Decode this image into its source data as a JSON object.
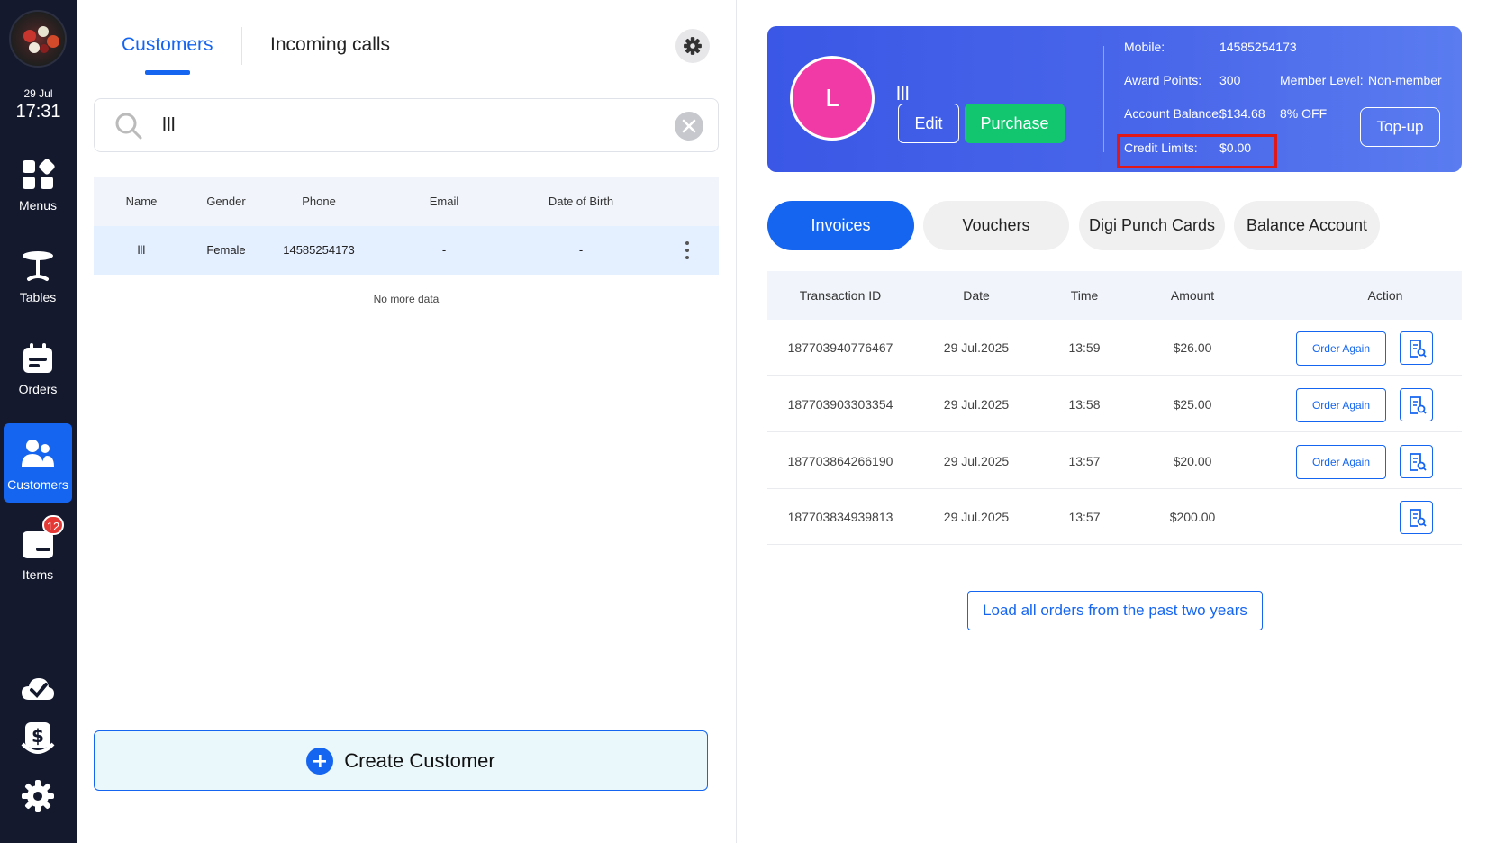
{
  "sidebar": {
    "date": "29 Jul",
    "time": "17:31",
    "items": [
      {
        "label": "Menus",
        "icon": "menus-icon"
      },
      {
        "label": "Tables",
        "icon": "table-icon"
      },
      {
        "label": "Orders",
        "icon": "orders-icon"
      },
      {
        "label": "Customers",
        "icon": "customers-icon",
        "active": true
      },
      {
        "label": "Items",
        "icon": "items-icon",
        "badge": "12"
      }
    ],
    "bottom_icons": [
      "cloud-check-icon",
      "cash-icon",
      "settings-icon"
    ]
  },
  "left": {
    "tabs": [
      "Customers",
      "Incoming calls"
    ],
    "search": {
      "value": "lll"
    },
    "table": {
      "headers": [
        "Name",
        "Gender",
        "Phone",
        "Email",
        "Date of Birth"
      ],
      "rows": [
        {
          "name": "lll",
          "gender": "Female",
          "phone": "14585254173",
          "email": "-",
          "dob": "-"
        }
      ]
    },
    "no_more": "No more data",
    "create_label": "Create Customer"
  },
  "profile": {
    "initial": "L",
    "name": "lll",
    "edit_label": "Edit",
    "purchase_label": "Purchase",
    "mobile_label": "Mobile:",
    "mobile": "14585254173",
    "award_label": "Award Points:",
    "award": "300",
    "member_label": "Member Level:",
    "member": "Non-member",
    "balance_label": "Account Balance:",
    "balance": "$134.68",
    "discount": "8% OFF",
    "credit_label": "Credit Limits:",
    "credit": "$0.00",
    "topup_label": "Top-up",
    "colors": {
      "card": "#4a68ea",
      "avatar": "#f23aa6",
      "purchase": "#12c66f",
      "highlight": "#e01818"
    }
  },
  "pills": [
    "Invoices",
    "Vouchers",
    "Digi Punch Cards",
    "Balance Account"
  ],
  "invoices": {
    "headers": [
      "Transaction ID",
      "Date",
      "Time",
      "Amount",
      "Action"
    ],
    "order_again_label": "Order Again",
    "rows": [
      {
        "id": "187703940776467",
        "date": "29 Jul.2025",
        "time": "13:59",
        "amount": "$26.00"
      },
      {
        "id": "187703903303354",
        "date": "29 Jul.2025",
        "time": "13:58",
        "amount": "$25.00"
      },
      {
        "id": "187703864266190",
        "date": "29 Jul.2025",
        "time": "13:57",
        "amount": "$20.00"
      },
      {
        "id": "187703834939813",
        "date": "29 Jul.2025",
        "time": "13:57",
        "amount": "$200.00"
      }
    ]
  },
  "load_all_label": "Load all orders from the past two years",
  "accent": "#1565f0"
}
